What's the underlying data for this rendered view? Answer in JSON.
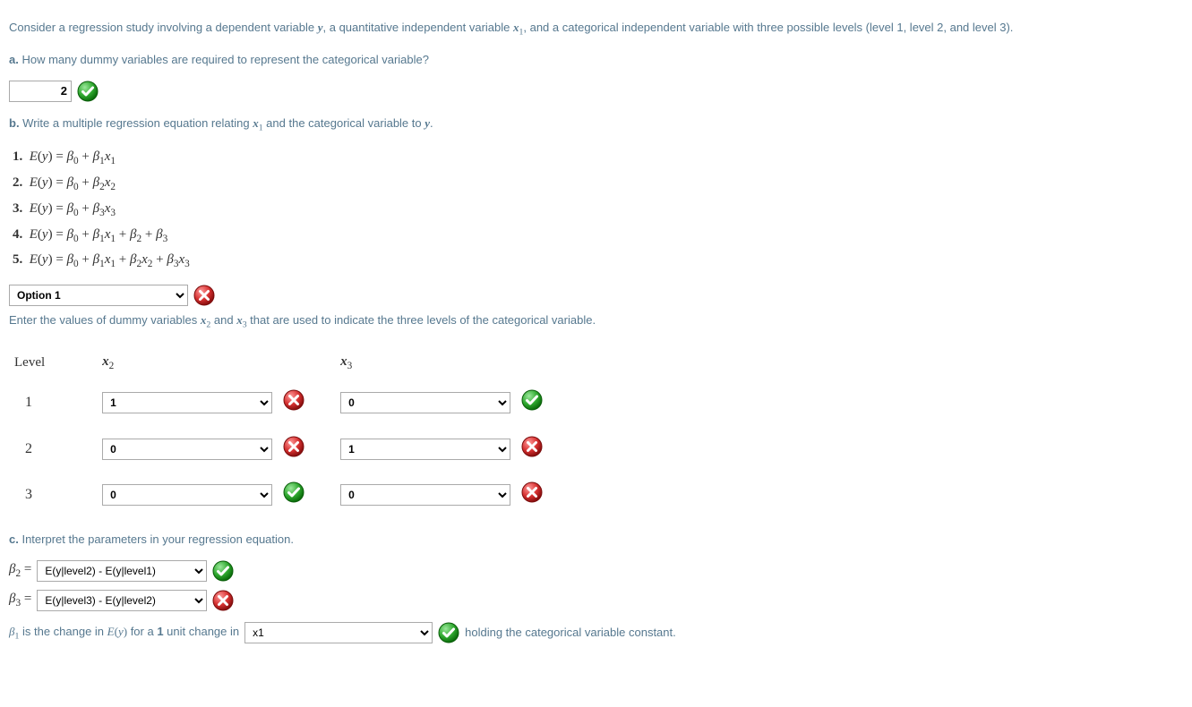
{
  "intro": {
    "text": "Consider a regression study involving a dependent variable y, a quantitative independent variable x₁, and a categorical independent variable with three possible levels (level 1, level 2, and level 3)."
  },
  "partA": {
    "label": "a.",
    "question": "How many dummy variables are required to represent the categorical variable?",
    "answer": "2",
    "mark": "correct"
  },
  "partB": {
    "label": "b.",
    "intro": "Write a multiple regression equation relating x₁ and the categorical variable to y.",
    "options": [
      "E(y) = β₀ + β₁x₁",
      "E(y) = β₀ + β₂x₂",
      "E(y) = β₀ + β₃x₃",
      "E(y) = β₀ + β₁x₁ + β₂ + β₃",
      "E(y) = β₀ + β₁x₁ + β₂x₂ + β₃x₃"
    ],
    "selected": "Option 1",
    "mark": "incorrect",
    "dummy_instr": "Enter the values of dummy variables x₂ and x₃ that are used to indicate the three levels of the categorical variable.",
    "table": {
      "head_level": "Level",
      "head_x2": "x₂",
      "head_x3": "x₃",
      "rows": [
        {
          "level": "1",
          "x2": "1",
          "x2_mark": "incorrect",
          "x3": "0",
          "x3_mark": "correct"
        },
        {
          "level": "2",
          "x2": "0",
          "x2_mark": "incorrect",
          "x3": "1",
          "x3_mark": "incorrect"
        },
        {
          "level": "3",
          "x2": "0",
          "x2_mark": "correct",
          "x3": "0",
          "x3_mark": "incorrect"
        }
      ]
    }
  },
  "partC": {
    "label": "c.",
    "question": "Interpret the parameters in your regression equation.",
    "beta2": {
      "label": "β₂ =",
      "value": "E(y|level2) - E(y|level1)",
      "mark": "correct"
    },
    "beta3": {
      "label": "β₃ =",
      "value": "E(y|level3) - E(y|level2)",
      "mark": "incorrect"
    },
    "beta1_pre": "β₁ is the change in E(y) for a 1 unit change in",
    "beta1_sel": "x1",
    "beta1_mark": "correct",
    "beta1_post": "holding the categorical variable constant."
  }
}
